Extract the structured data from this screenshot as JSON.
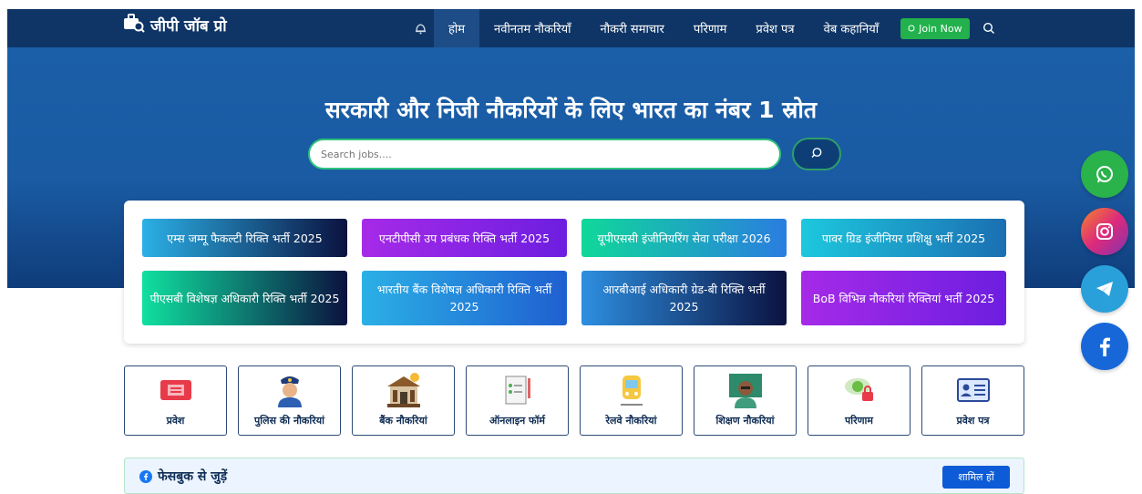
{
  "brand": {
    "name": "जीपी जॉब प्रो",
    "icon": "briefcase-search-icon"
  },
  "nav": {
    "items": [
      "होम",
      "नवीनतम नौकरियाँ",
      "नौकरी समाचार",
      "परिणाम",
      "प्रवेश पत्र",
      "वेब कहानियाँ"
    ],
    "active": "होम",
    "join_label": "Join Now"
  },
  "hero": {
    "title": "सरकारी और निजी नौकरियों के लिए भारत का नंबर 1 स्रोत",
    "search_placeholder": "Search jobs...."
  },
  "jobs": [
    "एम्स जम्मू फैकल्टी रिक्ति भर्ती 2025",
    "एनटीपीसी उप प्रबंधक रिक्ति भर्ती 2025",
    "यूपीएससी इंजीनियरिंग सेवा परीक्षा 2026",
    "पावर ग्रिड इंजीनियर प्रशिक्षु भर्ती 2025",
    "पीएसबी विशेषज्ञ अधिकारी रिक्ति भर्ती 2025",
    "भारतीय बैंक विशेषज्ञ अधिकारी रिक्ति भर्ती 2025",
    "आरबीआई अधिकारी ग्रेड-बी रिक्ति भर्ती 2025",
    "BoB विभिन्न नौकरियां रिक्तियां भर्ती 2025"
  ],
  "categories": [
    {
      "label": "प्रवेश",
      "icon": "ticket-icon"
    },
    {
      "label": "पुलिस की नौकरियां",
      "icon": "police-officer-icon"
    },
    {
      "label": "बैंक नौकरियां",
      "icon": "bank-icon"
    },
    {
      "label": "ऑनलाइन फॉर्म",
      "icon": "online-form-icon"
    },
    {
      "label": "रेलवे नौकरियां",
      "icon": "train-icon"
    },
    {
      "label": "शिक्षण नौकरियां",
      "icon": "teacher-icon"
    },
    {
      "label": "परिणाम",
      "icon": "result-eye-icon"
    },
    {
      "label": "प्रवेश पत्र",
      "icon": "id-card-icon"
    }
  ],
  "facebook": {
    "title": "फेसबुक से जुड़ें",
    "button": "शामिल हों"
  },
  "social": [
    "whatsapp-icon",
    "instagram-icon",
    "telegram-icon",
    "facebook-icon"
  ],
  "colors": {
    "navbar": "#0f3566",
    "hero": "#1b5fa8",
    "join": "#22b14c",
    "fb_button": "#0d5bd6"
  }
}
